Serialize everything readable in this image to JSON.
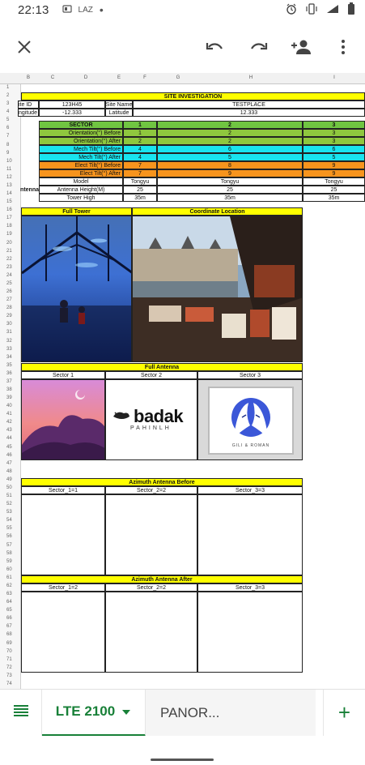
{
  "status_bar": {
    "time": "22:13",
    "carrier": "LAZ",
    "dot": "•"
  },
  "toolbar": {
    "icons": [
      "close-icon",
      "undo-icon",
      "redo-icon",
      "add-person-icon",
      "more-vert-icon"
    ]
  },
  "columns": [
    "B",
    "C",
    "D",
    "E",
    "F",
    "G",
    "H",
    "I"
  ],
  "rows": [
    "1",
    "2",
    "3",
    "4",
    "5",
    "6",
    "7",
    "8",
    "9",
    "10",
    "11",
    "12",
    "13",
    "14",
    "15",
    "16",
    "17",
    "18",
    "19",
    "20",
    "21",
    "22",
    "23",
    "24",
    "25",
    "26",
    "27",
    "28",
    "29",
    "30",
    "31",
    "32",
    "33",
    "34",
    "35",
    "36",
    "37",
    "38",
    "39",
    "40",
    "41",
    "42",
    "43",
    "44",
    "45",
    "46",
    "47",
    "48",
    "49",
    "50",
    "51",
    "52",
    "53",
    "54",
    "55",
    "56",
    "57",
    "58",
    "59",
    "60",
    "61",
    "62",
    "63",
    "64",
    "65",
    "66",
    "67",
    "68",
    "69",
    "70",
    "71",
    "72",
    "73",
    "74"
  ],
  "sheet": {
    "title": "SITE INVESTIGATION",
    "site_id_label": "ite ID",
    "site_id_value": "123H45",
    "site_name_label": "Site Name",
    "site_name_value": "TESTPLACE",
    "longitude_label": "ngitude",
    "longitude_value": "-12.333",
    "latitude_label": "Latitude",
    "latitude_value": "12.333",
    "sector_label": "SECTOR",
    "sectors": [
      "1",
      "2",
      "3"
    ],
    "params": [
      {
        "label": "Orientation(°) Before",
        "values": [
          "1",
          "2",
          "3"
        ]
      },
      {
        "label": "Orientation(°) After",
        "values": [
          "2",
          "2",
          "3"
        ]
      },
      {
        "label": "Mech Tilt(°) Before",
        "values": [
          "4",
          "6",
          "6"
        ]
      },
      {
        "label": "Mech Tilt(°) After",
        "values": [
          "4",
          "5",
          "5"
        ]
      },
      {
        "label": "Elect Tilt(°) Before",
        "values": [
          "7",
          "8",
          "9"
        ]
      },
      {
        "label": "Elect Tilt(°) After",
        "values": [
          "7",
          "9",
          "9"
        ]
      }
    ],
    "antenna_label": "ntenna",
    "model_label": "Model",
    "model_values": [
      "Tongyu",
      "Tongyu",
      "Tongyu"
    ],
    "height_label": "Antenna Height(M)",
    "height_values": [
      "25",
      "25",
      "25"
    ],
    "tower_label": "Tower High",
    "tower_values": [
      "35m",
      "35m",
      "35m"
    ],
    "full_tower": "Full Tower",
    "coordinate_location": "Coordinate Location",
    "full_antenna": "Full Antenna",
    "antenna_sectors": [
      "Sector 1",
      "Sector 2",
      "Sector 3"
    ],
    "logo_text": "badak",
    "logo_subtext": "PAHINLH",
    "frame_caption": "GILI & ROMAN",
    "azimuth_before": "Azimuth Antenna Before",
    "azimuth_before_sectors": [
      "Sector_1=1",
      "Sector_2=2",
      "Sector_3=3"
    ],
    "azimuth_after": "Azimuth Antenna After",
    "azimuth_after_sectors": [
      "Sector_1=2",
      "Sector_2=2",
      "Sector_3=3"
    ]
  },
  "tabs": {
    "active": "LTE 2100",
    "other": "PANOR...",
    "add": "+"
  },
  "colors": {
    "yellow": "#ffff00",
    "green": "#70c541",
    "cyan": "#19e4ef",
    "orange": "#f7941d",
    "accent": "#188038"
  }
}
